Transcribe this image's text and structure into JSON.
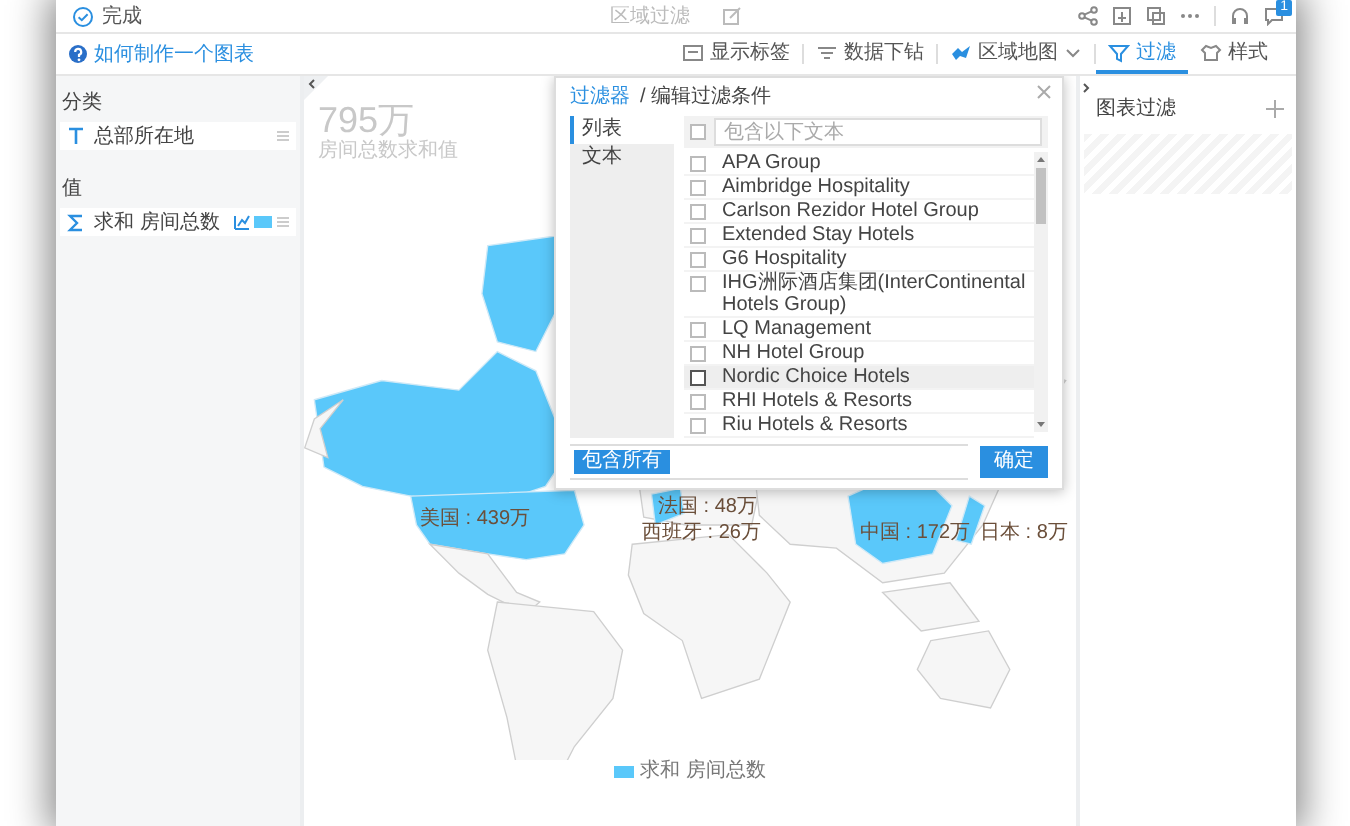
{
  "header": {
    "done_label": "完成",
    "title": "区域过滤",
    "notification_count": "1"
  },
  "toolbar": {
    "help_link": "如何制作一个图表",
    "items": [
      {
        "kind": "labels",
        "label": "显示标签",
        "selected": false,
        "dropdown": false
      },
      {
        "kind": "drilldown",
        "label": "数据下钻",
        "selected": false,
        "dropdown": false
      },
      {
        "kind": "map",
        "label": "区域地图",
        "selected": false,
        "dropdown": true
      },
      {
        "kind": "filter",
        "label": "过滤",
        "selected": true,
        "dropdown": false
      },
      {
        "kind": "style",
        "label": "样式",
        "selected": false,
        "dropdown": false
      }
    ]
  },
  "fields": {
    "sections": [
      {
        "heading": "分类",
        "items": [
          {
            "kind": "dimension",
            "label": "总部所在地"
          }
        ]
      },
      {
        "heading": "值",
        "items": [
          {
            "kind": "measure",
            "label": "求和 房间总数",
            "color": "#5ac8fa"
          }
        ]
      }
    ]
  },
  "chart": {
    "total": "795万",
    "total_caption": "房间总数求和值",
    "labels": [
      {
        "text": "美国 : 439万"
      },
      {
        "text": "法国 : 48万"
      },
      {
        "text": "西班牙 : 26万"
      },
      {
        "text": "中国 : 172万"
      },
      {
        "text": "日本 : 8万"
      }
    ],
    "legend": "求和 房间总数"
  },
  "filter_dialog": {
    "breadcrumb_link": "过滤器",
    "title": "/ 编辑过滤条件",
    "tabs": [
      {
        "label": "列表",
        "selected": true
      },
      {
        "label": "文本",
        "selected": false
      }
    ],
    "search": {
      "placeholder": "包含以下文本"
    },
    "select_all_checked": false,
    "options": [
      {
        "label": "APA Group",
        "checked": false,
        "hovered": false
      },
      {
        "label": "Aimbridge Hospitality",
        "checked": false,
        "hovered": false
      },
      {
        "label": "Carlson Rezidor Hotel Group",
        "checked": false,
        "hovered": false
      },
      {
        "label": "Extended Stay Hotels",
        "checked": false,
        "hovered": false
      },
      {
        "label": "G6 Hospitality",
        "checked": false,
        "hovered": false
      },
      {
        "label": "IHG洲际酒店集团(InterContinental Hotels Group)",
        "checked": false,
        "hovered": false
      },
      {
        "label": "LQ Management",
        "checked": false,
        "hovered": false
      },
      {
        "label": "NH Hotel Group",
        "checked": false,
        "hovered": false
      },
      {
        "label": "Nordic Choice Hotels",
        "checked": false,
        "hovered": true
      },
      {
        "label": "RHI Hotels & Resorts",
        "checked": false,
        "hovered": false
      },
      {
        "label": "Riu Hotels & Resorts",
        "checked": false,
        "hovered": false
      }
    ],
    "include_all_button": "包含所有",
    "confirm_button": "确定"
  },
  "side_filter": {
    "title": "图表过滤"
  }
}
